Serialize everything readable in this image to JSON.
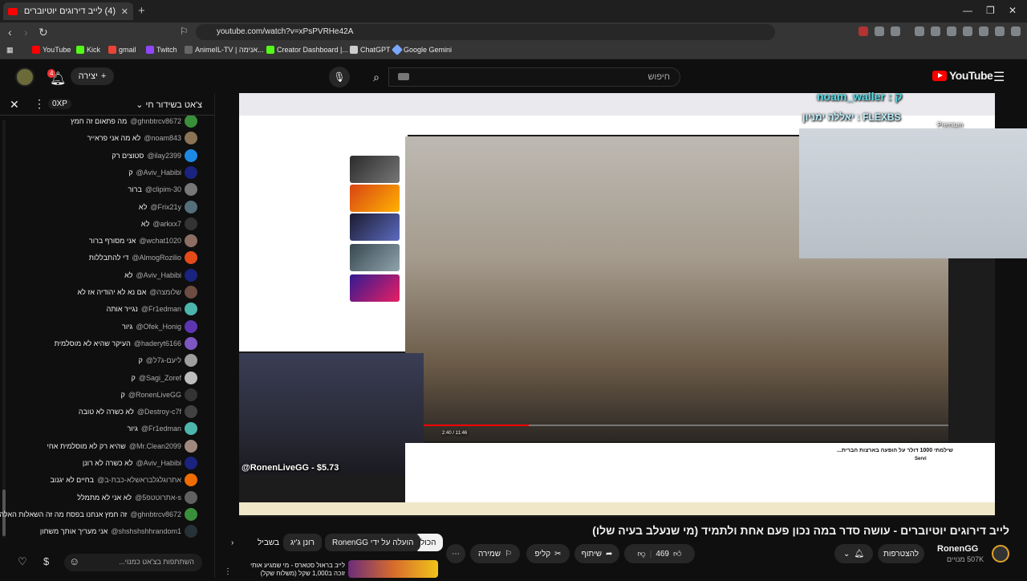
{
  "browser": {
    "tab_title": "(4) לייב דירוגים יוטיוברים - עשו",
    "url": "youtube.com/watch?v=xPsPVRHe42A",
    "bookmarks": [
      {
        "label": "YouTube",
        "color": "#ff0000"
      },
      {
        "label": "Kick",
        "color": "#53fc18"
      },
      {
        "label": "gmail",
        "color": "#ea4335"
      },
      {
        "label": "Twitch",
        "color": "#9146ff"
      },
      {
        "label": "AnimeIL-TV | אנימה...",
        "color": "#666666"
      },
      {
        "label": "Creator Dashboard |...",
        "color": "#53fc18"
      },
      {
        "label": "ChatGPT",
        "color": "#cccccc"
      },
      {
        "label": "Google Gemini",
        "color": "#7aa7ff"
      }
    ]
  },
  "header": {
    "notif_count": "4",
    "create_label": "יצירה",
    "search_placeholder": "חיפוש",
    "logo_text": "YouTube"
  },
  "chat": {
    "title": "צ'אט בשידור חי",
    "xp": "0XP",
    "messages": [
      {
        "user": "@ghnbtrcv8672",
        "text": "מה פתאום זה חמץ",
        "color": "#3a8f3a"
      },
      {
        "user": "@noam843",
        "text": "לא מה אני פראייר",
        "color": "#8b7355"
      },
      {
        "user": "@ilay2399",
        "text": "סטוצים רק",
        "color": "#1e88e5"
      },
      {
        "user": "@Aviv_Habibi",
        "text": "ק",
        "color": "#1a237e"
      },
      {
        "user": "@clipim-30",
        "text": "ברור",
        "color": "#777777"
      },
      {
        "user": "@Frix21y",
        "text": "לא",
        "color": "#546e7a"
      },
      {
        "user": "@arkxx7",
        "text": "לא",
        "color": "#333333"
      },
      {
        "user": "@wchat1020",
        "text": "אני מסורף ברור",
        "color": "#8d6e63"
      },
      {
        "user": "@AlmogRozilio",
        "text": "די להתבללות",
        "color": "#e64a19"
      },
      {
        "user": "@Aviv_Habibi",
        "text": "לא",
        "color": "#1a237e"
      },
      {
        "user": "@שלומצה",
        "text": "אם נא לא יהודיה אז לא",
        "color": "#6d4c41"
      },
      {
        "user": "@Fr1edman",
        "text": "נגייר אותה",
        "color": "#4db6ac"
      },
      {
        "user": "@Ofek_Honig",
        "text": "גיור",
        "color": "#5e35b1"
      },
      {
        "user": "@haderyt6166",
        "text": "העיקר שהיא לא מוסלמית",
        "color": "#7e57c2"
      },
      {
        "user": "@ליעם-ג7ל",
        "text": "ק",
        "color": "#9e9e9e"
      },
      {
        "user": "@Sagi_Zoref",
        "text": "ק",
        "color": "#bdbdbd"
      },
      {
        "user": "@RonenLiveGG",
        "text": "ק",
        "color": "#333333"
      },
      {
        "user": "@Destroy-c7f",
        "text": "לא כשרה לא טובה",
        "color": "#424242"
      },
      {
        "user": "@Fr1edman",
        "text": "גיור",
        "color": "#4db6ac"
      },
      {
        "user": "@Mr.Clean2099",
        "text": "שהיא רק לא מוסלמית אחי",
        "color": "#a1887f"
      },
      {
        "user": "@Aviv_Habibi",
        "text": "לא כשרה לא רונן",
        "color": "#1a237e"
      },
      {
        "user": "@אתרוגלגלבראשלא-כבת-ב",
        "text": "בחיים לא יגנוב",
        "color": "#ef6c00"
      },
      {
        "user": "@אתרוטטפ5-s",
        "text": "לא אני לא מתמלל",
        "color": "#616161"
      },
      {
        "user": "@ghnbtrcv8672",
        "text": "זה חמץ אנחנו בפסח מה זה השאלות האלה ראון",
        "color": "#3a8f3a"
      },
      {
        "user": "@shshshshhrandom1",
        "text": "אני מעריך אותך משחון",
        "color": "#263238"
      }
    ],
    "input_placeholder": "השתתפות בצ'אט כמנוי..."
  },
  "video": {
    "overlay_top_name": "noam_waller : ק",
    "overlay_name2": "יאללה ימניון : FLEXBS",
    "overlay_donation": "@RonenLiveGG - $5.73",
    "premium_label": "Premium",
    "time": "2:40 / 11:46",
    "inner_title": "שילמתי 1000 דולר על הופעה בארצות הברית...",
    "inner_channel": "Servi",
    "progress_fraction": 0.2
  },
  "below": {
    "title": "לייב דירוגים יוטיוברים - עושה סדר במה נכון פעם אחת ולתמיד (מי שנעלב בעיה שלו)",
    "chips": [
      "הכול",
      "הועלה על ידי RonenGG",
      "רונן ג'יג",
      "בשביל"
    ],
    "channel_name": "RonenGG",
    "subscribers": "507K מנויים",
    "subscribe_label": "להצטרפות",
    "likes": "469",
    "share_label": "שיתוף",
    "clip_label": "קליפ",
    "save_label": "שמירה",
    "next_video": "לייב בראול סטארס - מי שמגיע אותי זוכה ב1,000 שקל (משלוח שקל)"
  }
}
